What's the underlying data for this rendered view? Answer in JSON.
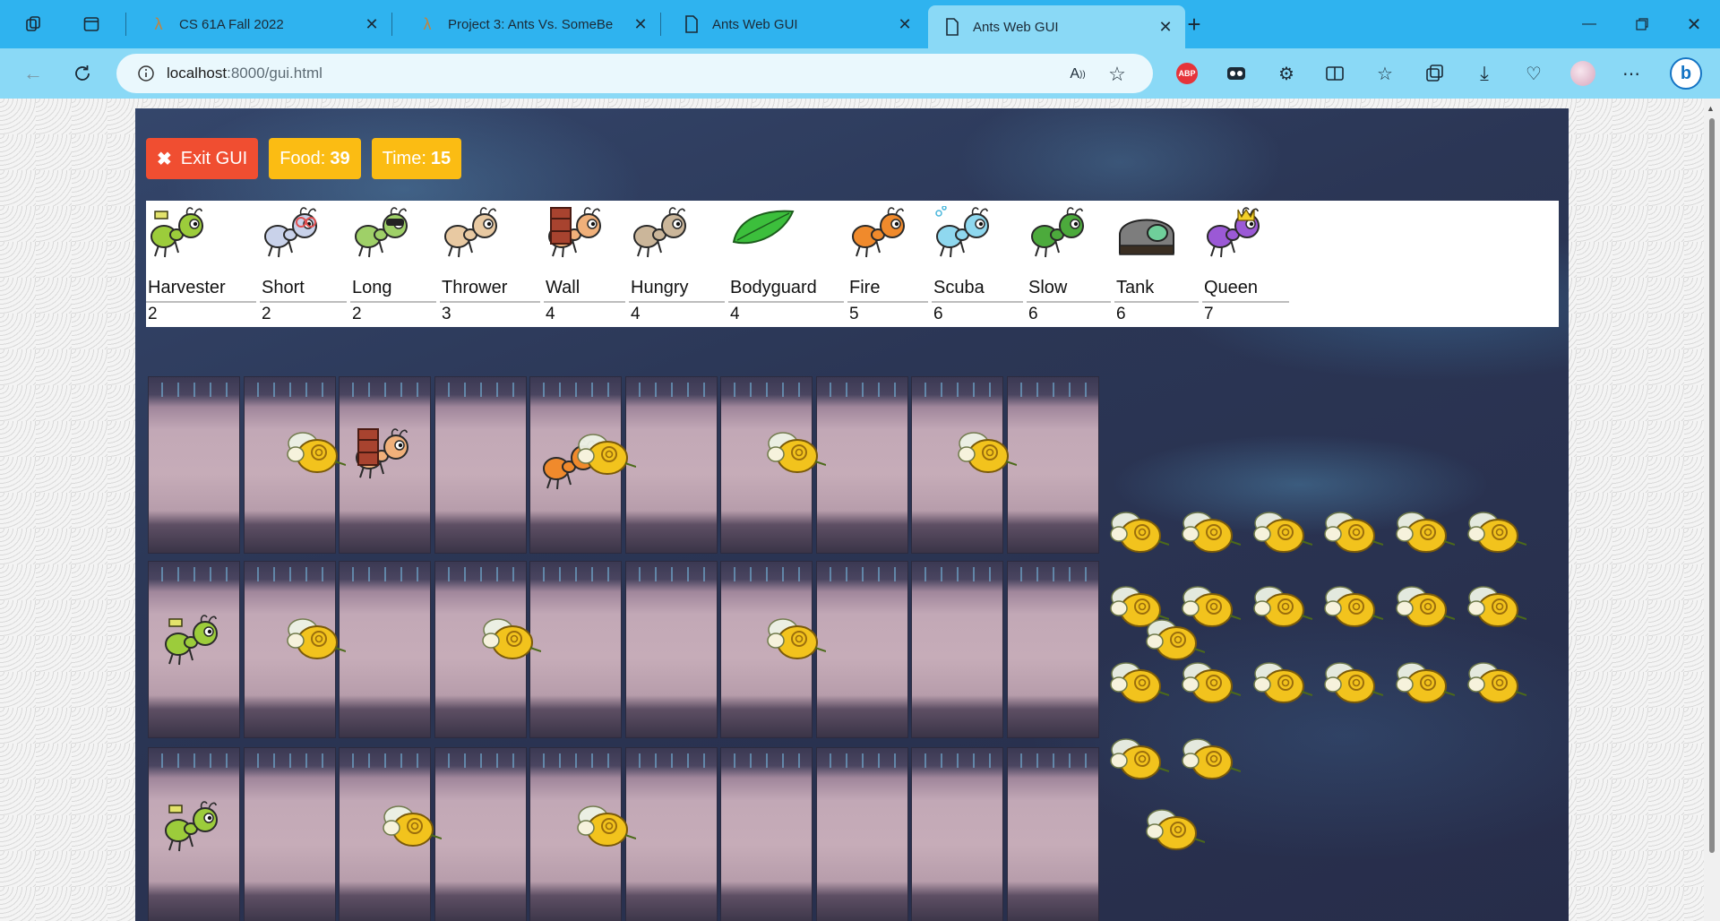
{
  "browser": {
    "tabs": [
      {
        "title": "CS 61A Fall 2022",
        "icon": "lambda-icon"
      },
      {
        "title": "Project 3: Ants Vs. SomeBe",
        "icon": "lambda-icon"
      },
      {
        "title": "Ants Web GUI",
        "icon": "document-icon"
      },
      {
        "title": "Ants Web GUI",
        "icon": "document-icon",
        "active": true
      }
    ],
    "url_host": "localhost",
    "url_path": ":8000/gui.html"
  },
  "game": {
    "exit_label": "Exit GUI",
    "food_label": "Food:",
    "food_value": "39",
    "time_label": "Time:",
    "time_value": "15",
    "ant_types": [
      {
        "name": "Harvester",
        "cost": "2",
        "color": "#9ccc3b"
      },
      {
        "name": "Short",
        "cost": "2",
        "color": "#c9d2ea"
      },
      {
        "name": "Long",
        "cost": "2",
        "color": "#9fd068"
      },
      {
        "name": "Thrower",
        "cost": "3",
        "color": "#e8c9a2"
      },
      {
        "name": "Wall",
        "cost": "4",
        "color": "#f0b07a"
      },
      {
        "name": "Hungry",
        "cost": "4",
        "color": "#cbb69a"
      },
      {
        "name": "Bodyguard",
        "cost": "4",
        "color": "#3cbf3c"
      },
      {
        "name": "Fire",
        "cost": "5",
        "color": "#f08a2c"
      },
      {
        "name": "Scuba",
        "cost": "6",
        "color": "#8fd8ef"
      },
      {
        "name": "Slow",
        "cost": "6",
        "color": "#4caa3c"
      },
      {
        "name": "Tank",
        "cost": "6",
        "color": "#8e8e8e"
      },
      {
        "name": "Queen",
        "cost": "7",
        "color": "#9b59d6"
      }
    ]
  }
}
